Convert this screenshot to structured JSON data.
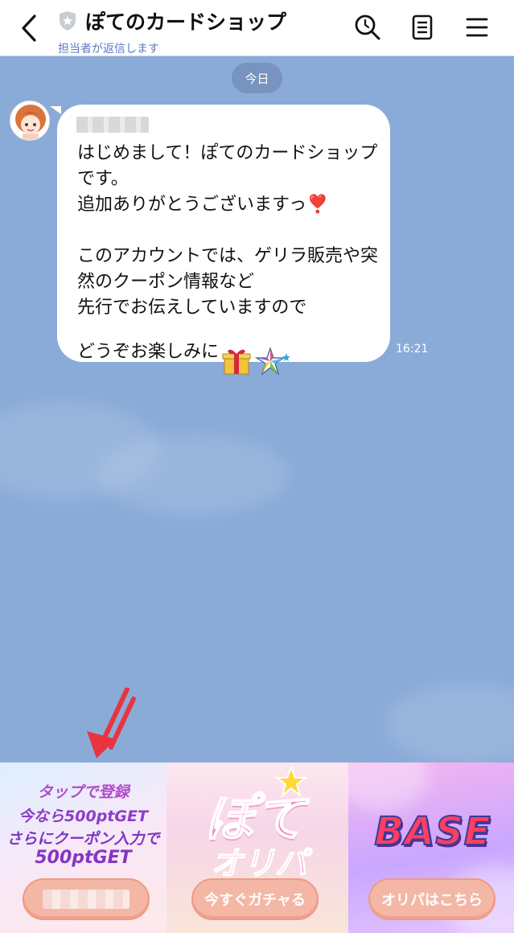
{
  "header": {
    "title": "ぽてのカードショップ",
    "subtitle": "担当者が返信します",
    "icons": [
      "back-chevron-icon",
      "shield-icon",
      "search-icon",
      "notes-icon",
      "menu-icon"
    ]
  },
  "chat": {
    "date_divider": "今日",
    "sender_name": "■■■ ■■",
    "message": "はじめまして！ぽてのカードショップです。\n追加ありがとうございますっ❣️\n\nこのアカウントでは、ゲリラ販売や突然のクーポン情報など\n先行でお伝えしていますので\nどうぞお楽しみに",
    "message_emojis": [
      "gift-icon",
      "star-icon"
    ],
    "time": "16:21",
    "background_color": "#8aabd8"
  },
  "rich_menu": {
    "panel1": {
      "line1": "タップで登録",
      "line2": "今なら500ptGET",
      "line3": "さらにクーポン入力で",
      "line4": "500ptGET",
      "button_label": "■■■■■■■"
    },
    "panel2": {
      "title": "ぽて",
      "subtitle": "オリパ",
      "button_label": "今すぐガチャる"
    },
    "panel3": {
      "title": "BASE",
      "button_label": "オリパはこちら"
    }
  },
  "colors": {
    "accent_link": "#5b79c3",
    "arrow": "#e8343e",
    "button_fill": "#f4b7a6"
  }
}
